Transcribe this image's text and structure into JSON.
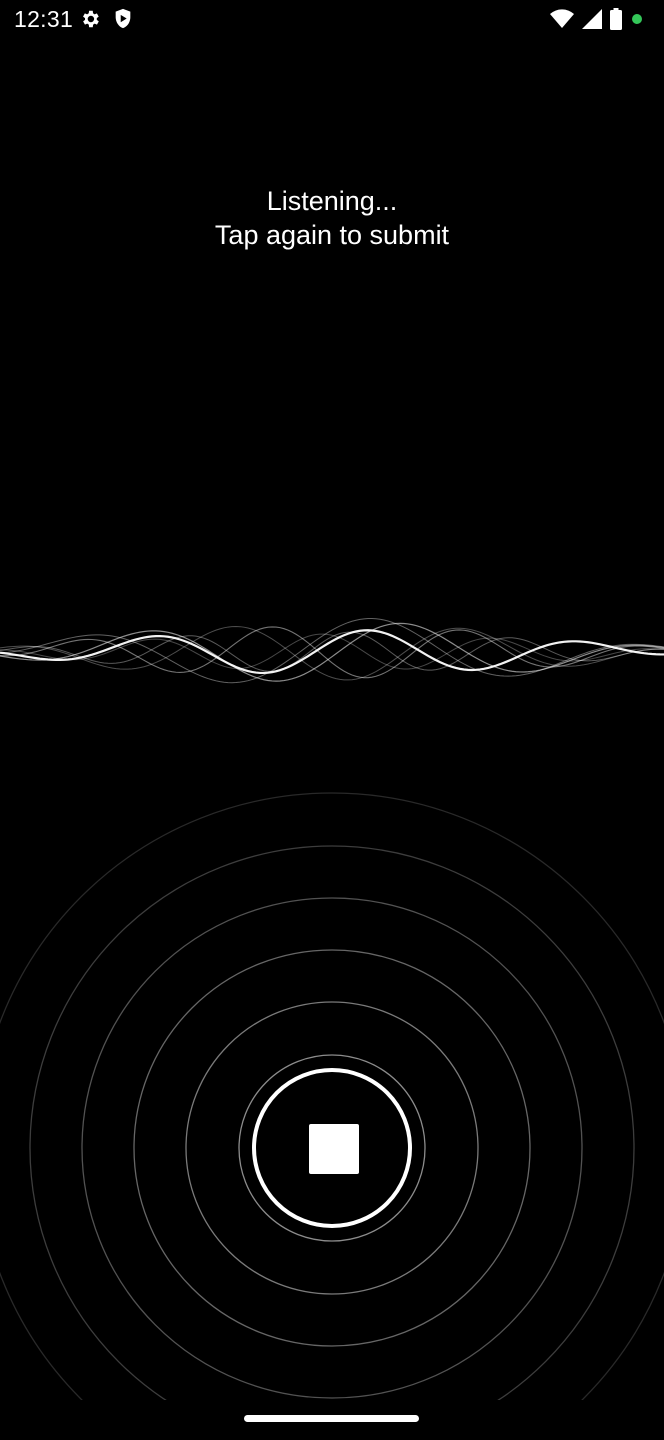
{
  "status_bar": {
    "time": "12:31",
    "left_icons": [
      "gear-icon",
      "shield-play-icon"
    ],
    "right_icons": [
      "wifi-icon",
      "cellular-signal-icon",
      "battery-icon",
      "privacy-indicator-dot"
    ],
    "privacy_dot_color": "#34c759"
  },
  "prompt": {
    "line1": "Listening...",
    "line2": "Tap again to submit"
  },
  "controls": {
    "stop_button_icon": "stop-icon"
  },
  "colors": {
    "background": "#000000",
    "foreground": "#ffffff"
  }
}
